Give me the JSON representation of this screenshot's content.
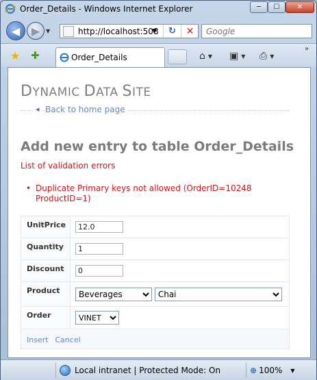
{
  "window": {
    "title": "Order_Details - Windows Internet Explorer",
    "minimize_glyph": "─",
    "maximize_glyph": "☐",
    "close_glyph": "✕"
  },
  "navigation": {
    "back_glyph": "◀",
    "forward_glyph": "▶",
    "address_url": "http://localhost:508",
    "search_placeholder": "Google"
  },
  "tabs": {
    "active_tab_label": "Order_Details"
  },
  "page": {
    "site_title_parts": [
      "D",
      "YNAMIC ",
      "D",
      "ATA ",
      "S",
      "ITE"
    ],
    "back_link": "Back to home page",
    "heading": "Add new entry to table Order_Details",
    "validation_header": "List of validation errors",
    "validation_errors": [
      "Duplicate Primary keys not allowed (OrderID=10248 ProductID=1)"
    ],
    "form": {
      "fields": [
        {
          "label": "UnitPrice",
          "value": "12.0"
        },
        {
          "label": "Quantity",
          "value": "1"
        },
        {
          "label": "Discount",
          "value": "0"
        }
      ],
      "product": {
        "label": "Product",
        "category_selected": "Beverages",
        "product_selected": "Chai"
      },
      "order": {
        "label": "Order",
        "selected": "VINET"
      },
      "insert_link": "Insert",
      "cancel_link": "Cancel"
    }
  },
  "status": {
    "zone_text": "Local intranet | Protected Mode: On",
    "zoom_text": "100%"
  }
}
